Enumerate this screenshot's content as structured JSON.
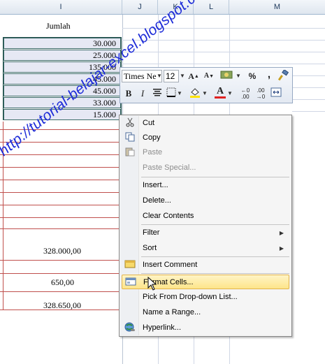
{
  "columns": {
    "i": "I",
    "j": "J",
    "k": "K",
    "l": "L",
    "m": "M"
  },
  "sheet": {
    "header_jumlah": "Jumlah",
    "selected_values": [
      "30.000",
      "25.000",
      "135.000",
      "45.000",
      "45.000",
      "33.000",
      "15.000"
    ],
    "total_1": "328.000,00",
    "value_2": "650,00",
    "total_2": "328.650,00"
  },
  "watermark": "http://tutorial-belajar-excel.blogspot.com/",
  "mini_toolbar": {
    "font_name": "Times Ne",
    "font_size": "12",
    "bold": "B",
    "italic": "I",
    "percent": "%",
    "comma": ",",
    "font_color_icon": "A",
    "increase_font_icon": "A",
    "decrease_font_icon": "A",
    "accent_font_color": "#e02020",
    "accent_fill_color": "#ffe400"
  },
  "context_menu": {
    "items": [
      {
        "label": "Cut",
        "icon": "scissors-icon",
        "enabled": true
      },
      {
        "label": "Copy",
        "icon": "copy-icon",
        "enabled": true
      },
      {
        "label": "Paste",
        "icon": "paste-icon",
        "enabled": false
      },
      {
        "label": "Paste Special...",
        "icon": "",
        "enabled": false
      },
      {
        "label": "Insert...",
        "icon": "",
        "enabled": true
      },
      {
        "label": "Delete...",
        "icon": "",
        "enabled": true
      },
      {
        "label": "Clear Contents",
        "icon": "",
        "enabled": true
      },
      {
        "label": "Filter",
        "icon": "",
        "enabled": true,
        "submenu": true
      },
      {
        "label": "Sort",
        "icon": "",
        "enabled": true,
        "submenu": true
      },
      {
        "label": "Insert Comment",
        "icon": "comment-icon",
        "enabled": true
      },
      {
        "label": "Format Cells...",
        "icon": "format-cells-icon",
        "enabled": true,
        "highlighted": true
      },
      {
        "label": "Pick From Drop-down List...",
        "icon": "",
        "enabled": true
      },
      {
        "label": "Name a Range...",
        "icon": "",
        "enabled": true
      },
      {
        "label": "Hyperlink...",
        "icon": "hyperlink-icon",
        "enabled": true
      }
    ]
  }
}
